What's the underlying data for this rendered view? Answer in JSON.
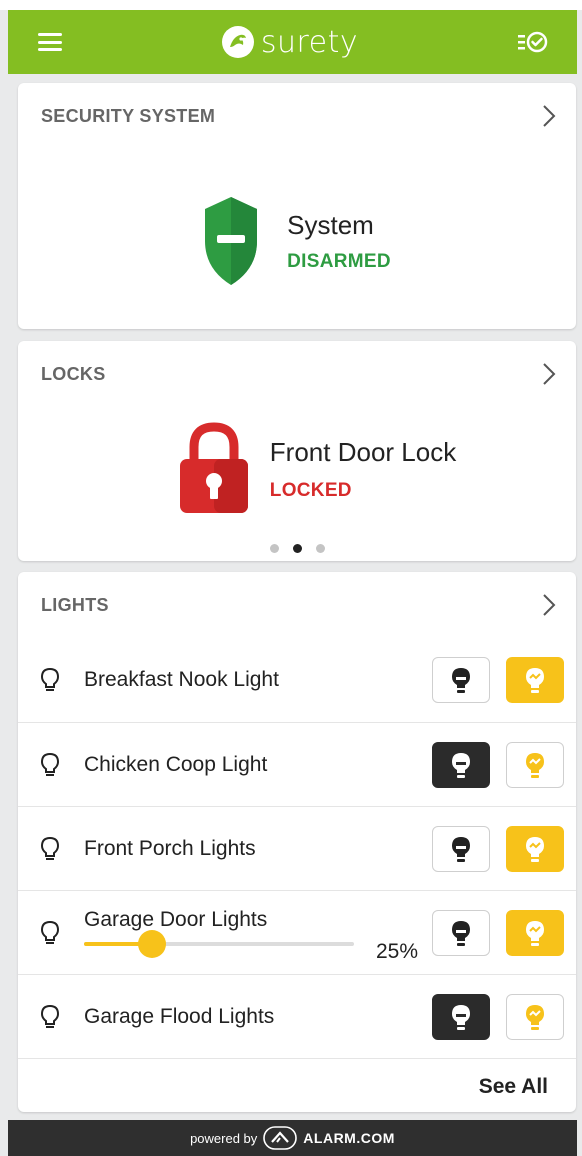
{
  "app": {
    "logo_text": "surety"
  },
  "security": {
    "title": "SECURITY SYSTEM",
    "name": "System",
    "status": "DISARMED",
    "status_color": "#2e9c42"
  },
  "locks": {
    "title": "LOCKS",
    "name": "Front Door Lock",
    "status": "LOCKED",
    "status_color": "#d72b2b",
    "page_count": 3,
    "active_page": 2
  },
  "lights": {
    "title": "LIGHTS",
    "items": [
      {
        "name": "Breakfast Nook Light",
        "state": "on"
      },
      {
        "name": "Chicken Coop Light",
        "state": "off"
      },
      {
        "name": "Front Porch Lights",
        "state": "on"
      },
      {
        "name": "Garage Door Lights",
        "state": "on",
        "dimmer_percent": 25,
        "dimmer_label": "25%"
      },
      {
        "name": "Garage Flood Lights",
        "state": "off"
      }
    ],
    "see_all_label": "See All"
  },
  "footer": {
    "powered_by": "powered by",
    "brand": "ALARM.COM"
  },
  "colors": {
    "brand_green": "#84be22",
    "light_on": "#f7c21a",
    "light_off": "#2b2b2b"
  }
}
